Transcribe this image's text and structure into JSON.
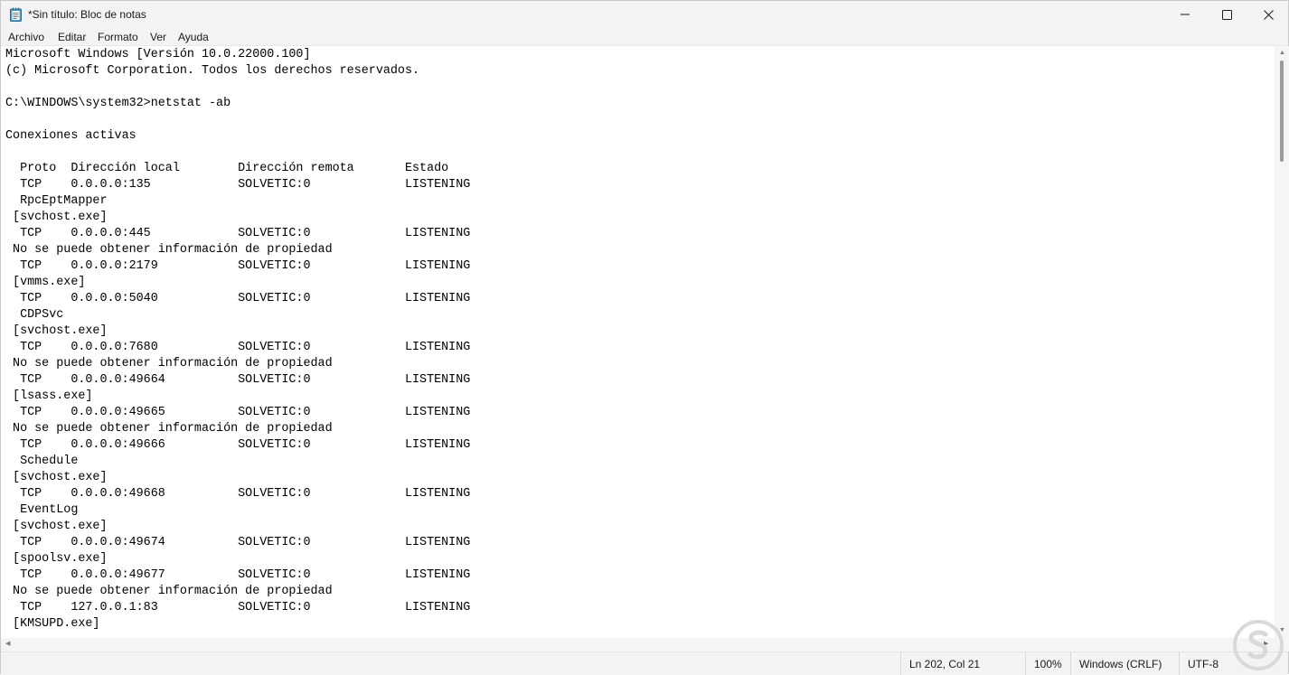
{
  "window": {
    "title": "*Sin título: Bloc de notas"
  },
  "menu": [
    {
      "label": "Archivo"
    },
    {
      "label": "Editar"
    },
    {
      "label": "Formato"
    },
    {
      "label": "Ver"
    },
    {
      "label": "Ayuda"
    }
  ],
  "editor": {
    "content": "Microsoft Windows [Versión 10.0.22000.100]\n(c) Microsoft Corporation. Todos los derechos reservados.\n\nC:\\WINDOWS\\system32>netstat -ab\n\nConexiones activas\n\n  Proto  Dirección local        Dirección remota       Estado\n  TCP    0.0.0.0:135            SOLVETIC:0             LISTENING\n  RpcEptMapper\n [svchost.exe]\n  TCP    0.0.0.0:445            SOLVETIC:0             LISTENING\n No se puede obtener información de propiedad\n  TCP    0.0.0.0:2179           SOLVETIC:0             LISTENING\n [vmms.exe]\n  TCP    0.0.0.0:5040           SOLVETIC:0             LISTENING\n  CDPSvc\n [svchost.exe]\n  TCP    0.0.0.0:7680           SOLVETIC:0             LISTENING\n No se puede obtener información de propiedad\n  TCP    0.0.0.0:49664          SOLVETIC:0             LISTENING\n [lsass.exe]\n  TCP    0.0.0.0:49665          SOLVETIC:0             LISTENING\n No se puede obtener información de propiedad\n  TCP    0.0.0.0:49666          SOLVETIC:0             LISTENING\n  Schedule\n [svchost.exe]\n  TCP    0.0.0.0:49668          SOLVETIC:0             LISTENING\n  EventLog\n [svchost.exe]\n  TCP    0.0.0.0:49674          SOLVETIC:0             LISTENING\n [spoolsv.exe]\n  TCP    0.0.0.0:49677          SOLVETIC:0             LISTENING\n No se puede obtener información de propiedad\n  TCP    127.0.0.1:83           SOLVETIC:0             LISTENING\n [KMSUPD.exe]"
  },
  "status": {
    "position": "Ln 202, Col 21",
    "zoom": "100%",
    "line_ending": "Windows (CRLF)",
    "encoding": "UTF-8"
  },
  "icons": {
    "app": "notepad-icon",
    "minimize": "minimize-icon",
    "maximize": "maximize-icon",
    "close": "close-icon",
    "logo": "solvetic-logo"
  },
  "colors": {
    "logo": "#d9d9d9",
    "chrome": "#f3f3f3"
  }
}
